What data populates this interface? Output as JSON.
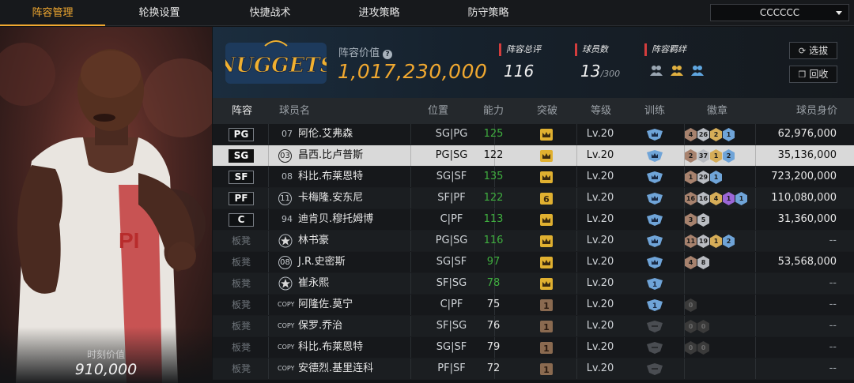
{
  "tabs": [
    {
      "label": "阵容管理",
      "active": true
    },
    {
      "label": "轮换设置",
      "active": false
    },
    {
      "label": "快捷战术",
      "active": false
    },
    {
      "label": "进攻策略",
      "active": false
    },
    {
      "label": "防守策略",
      "active": false
    }
  ],
  "team_select": {
    "value": "CCCCCC"
  },
  "portrait": {
    "value_label": "时刻价值",
    "value": "910,000"
  },
  "header": {
    "logo_text": "NUGGETS",
    "lineup_value_label": "阵容价值",
    "lineup_value": "1,017,230,000",
    "rating_label": "阵容总评",
    "rating": "116",
    "players_label": "球员数",
    "players": "13",
    "players_max": "/300",
    "bond_label": "阵容羁绊",
    "buttons": {
      "select": "选拔",
      "recycle": "回收"
    }
  },
  "table": {
    "headers": [
      "阵容",
      "球员名",
      "位置",
      "能力",
      "突破",
      "等级",
      "训练",
      "徽章",
      "球员身价"
    ],
    "rows": [
      {
        "slot": "PG",
        "starter": true,
        "jersey": "07",
        "jersey_style": "plain",
        "name": "阿伦.艾弗森",
        "pos": "SG|PG",
        "ability": "125",
        "ability_green": true,
        "break": "crown",
        "level": "Lv.20",
        "train": "crown",
        "badges": [
          [
            "bronze",
            "4"
          ],
          [
            "silver",
            "26"
          ],
          [
            "gold",
            "2"
          ],
          [
            "blue",
            "1"
          ]
        ],
        "price": "62,976,000",
        "selected": false
      },
      {
        "slot": "SG",
        "starter": true,
        "jersey": "03",
        "jersey_style": "ring",
        "name": "昌西.比卢普斯",
        "pos": "PG|SG",
        "ability": "122",
        "ability_green": false,
        "break": "crown",
        "level": "Lv.20",
        "train": "crown",
        "badges": [
          [
            "bronze",
            "2"
          ],
          [
            "silver",
            "37"
          ],
          [
            "gold",
            "1"
          ],
          [
            "blue",
            "2"
          ]
        ],
        "price": "35,136,000",
        "selected": true
      },
      {
        "slot": "SF",
        "starter": true,
        "jersey": "08",
        "jersey_style": "plain",
        "name": "科比.布莱恩特",
        "pos": "SG|SF",
        "ability": "135",
        "ability_green": true,
        "break": "crown",
        "level": "Lv.20",
        "train": "crown",
        "badges": [
          [
            "bronze",
            "1"
          ],
          [
            "silver",
            "29"
          ],
          [
            "blue",
            "1"
          ]
        ],
        "price": "723,200,000",
        "selected": false
      },
      {
        "slot": "PF",
        "starter": true,
        "jersey": "11",
        "jersey_style": "ring",
        "name": "卡梅隆.安东尼",
        "pos": "SF|PF",
        "ability": "122",
        "ability_green": true,
        "break": "6",
        "level": "Lv.20",
        "train": "crown",
        "badges": [
          [
            "bronze",
            "16"
          ],
          [
            "silver",
            "16"
          ],
          [
            "gold",
            "4"
          ],
          [
            "purple",
            "1"
          ],
          [
            "blue",
            "1"
          ]
        ],
        "price": "110,080,000",
        "selected": false
      },
      {
        "slot": "C",
        "starter": true,
        "jersey": "94",
        "jersey_style": "plain",
        "name": "迪肯贝.穆托姆博",
        "pos": "C|PF",
        "ability": "113",
        "ability_green": true,
        "break": "crown",
        "level": "Lv.20",
        "train": "crown",
        "badges": [
          [
            "bronze",
            "3"
          ],
          [
            "silver",
            "5"
          ]
        ],
        "price": "31,360,000",
        "selected": false
      },
      {
        "slot": "板凳",
        "starter": false,
        "jersey": "",
        "jersey_style": "star",
        "name": "林书豪",
        "pos": "PG|SG",
        "ability": "116",
        "ability_green": true,
        "break": "crown",
        "level": "Lv.20",
        "train": "crown",
        "badges": [
          [
            "bronze",
            "11"
          ],
          [
            "silver",
            "19"
          ],
          [
            "gold",
            "1"
          ],
          [
            "blue",
            "2"
          ]
        ],
        "price": "--",
        "selected": false
      },
      {
        "slot": "板凳",
        "starter": false,
        "jersey": "08",
        "jersey_style": "ring",
        "name": "J.R.史密斯",
        "pos": "SG|SF",
        "ability": "97",
        "ability_green": true,
        "break": "crown",
        "level": "Lv.20",
        "train": "crown",
        "badges": [
          [
            "bronze",
            "4"
          ],
          [
            "silver",
            "8"
          ]
        ],
        "price": "53,568,000",
        "selected": false
      },
      {
        "slot": "板凳",
        "starter": false,
        "jersey": "",
        "jersey_style": "star",
        "name": "崔永熙",
        "pos": "SF|SG",
        "ability": "78",
        "ability_green": true,
        "break": "crown",
        "level": "Lv.20",
        "train": "1",
        "badges": [],
        "price": "--",
        "selected": false
      },
      {
        "slot": "板凳",
        "starter": false,
        "jersey": "COPY",
        "jersey_style": "copy",
        "name": "阿隆佐.莫宁",
        "pos": "C|PF",
        "ability": "75",
        "ability_green": false,
        "break": "1",
        "level": "Lv.20",
        "train": "1",
        "badges": [
          [
            "empty",
            "0"
          ]
        ],
        "price": "--",
        "selected": false
      },
      {
        "slot": "板凳",
        "starter": false,
        "jersey": "COPY",
        "jersey_style": "copy",
        "name": "保罗.乔治",
        "pos": "SF|SG",
        "ability": "76",
        "ability_green": false,
        "break": "1",
        "level": "Lv.20",
        "train": "none",
        "badges": [
          [
            "empty",
            "0"
          ],
          [
            "empty",
            "0"
          ]
        ],
        "price": "--",
        "selected": false
      },
      {
        "slot": "板凳",
        "starter": false,
        "jersey": "COPY",
        "jersey_style": "copy",
        "name": "科比.布莱恩特",
        "pos": "SG|SF",
        "ability": "79",
        "ability_green": false,
        "break": "1",
        "level": "Lv.20",
        "train": "none",
        "badges": [
          [
            "empty",
            "0"
          ],
          [
            "empty",
            "0"
          ]
        ],
        "price": "--",
        "selected": false
      },
      {
        "slot": "板凳",
        "starter": false,
        "jersey": "COPY",
        "jersey_style": "copy",
        "name": "安德烈.基里连科",
        "pos": "PF|SF",
        "ability": "72",
        "ability_green": false,
        "break": "1",
        "level": "Lv.20",
        "train": "none",
        "badges": [],
        "price": "--",
        "selected": false
      }
    ]
  },
  "colors": {
    "accent": "#f0a830",
    "green": "#3fae3f",
    "stat_marker": "#d43d3d"
  }
}
